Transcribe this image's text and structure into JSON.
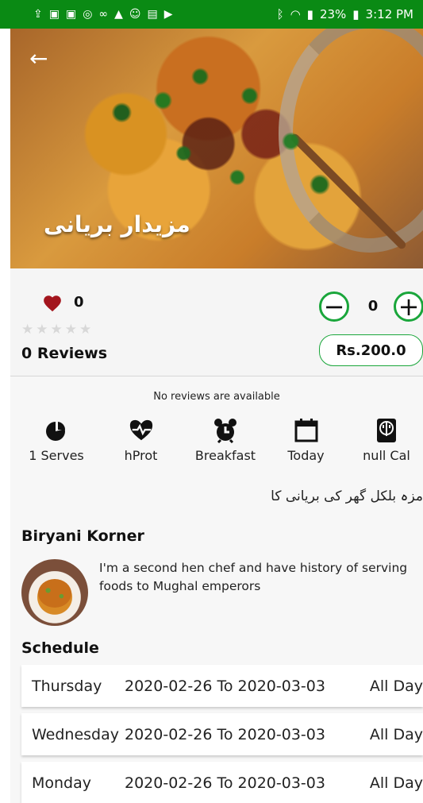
{
  "status_bar": {
    "left_icons": [
      "upload-icon",
      "youtube-icon",
      "youtube-icon",
      "circle-icon",
      "link-icon",
      "mm-icon",
      "smile-icon",
      "tv-icon",
      "play-icon"
    ],
    "battery": "23%",
    "time": "3:12 PM"
  },
  "hero": {
    "title": "مزیدار بریانی"
  },
  "details": {
    "likes": "0",
    "rating": 0,
    "rating_max": 5,
    "reviews_label": "0 Reviews",
    "quantity": "0",
    "price": "Rs.200.0",
    "no_reviews": "No reviews are available"
  },
  "metrics": [
    {
      "icon": "pie-chart-icon",
      "label": "1 Serves"
    },
    {
      "icon": "heart-pulse-icon",
      "label": "hProt"
    },
    {
      "icon": "alarm-clock-icon",
      "label": "Breakfast"
    },
    {
      "icon": "calendar-icon",
      "label": "Today"
    },
    {
      "icon": "cutlery-card-icon",
      "label": "null Cal"
    }
  ],
  "description": "مزہ بلکل گھر کی بریانی کا",
  "chef": {
    "name": "Biryani Korner",
    "bio": "I'm a second hen chef and have history of serving foods to Mughal emperors"
  },
  "schedule": {
    "title": "Schedule",
    "rows": [
      {
        "day": "Thursday",
        "start": "2020-02-26",
        "separator": "To",
        "end": "2020-03-03",
        "time": "All Day"
      },
      {
        "day": "Wednesday",
        "start": "2020-02-26",
        "separator": "To",
        "end": "2020-03-03",
        "time": "All Day"
      },
      {
        "day": "Monday",
        "start": "2020-02-26",
        "separator": "To",
        "end": "2020-03-03",
        "time": "All Day"
      }
    ]
  },
  "colors": {
    "status_bar": "#0a8a14",
    "accent": "#1aa63b",
    "heart": "#a3151d"
  }
}
